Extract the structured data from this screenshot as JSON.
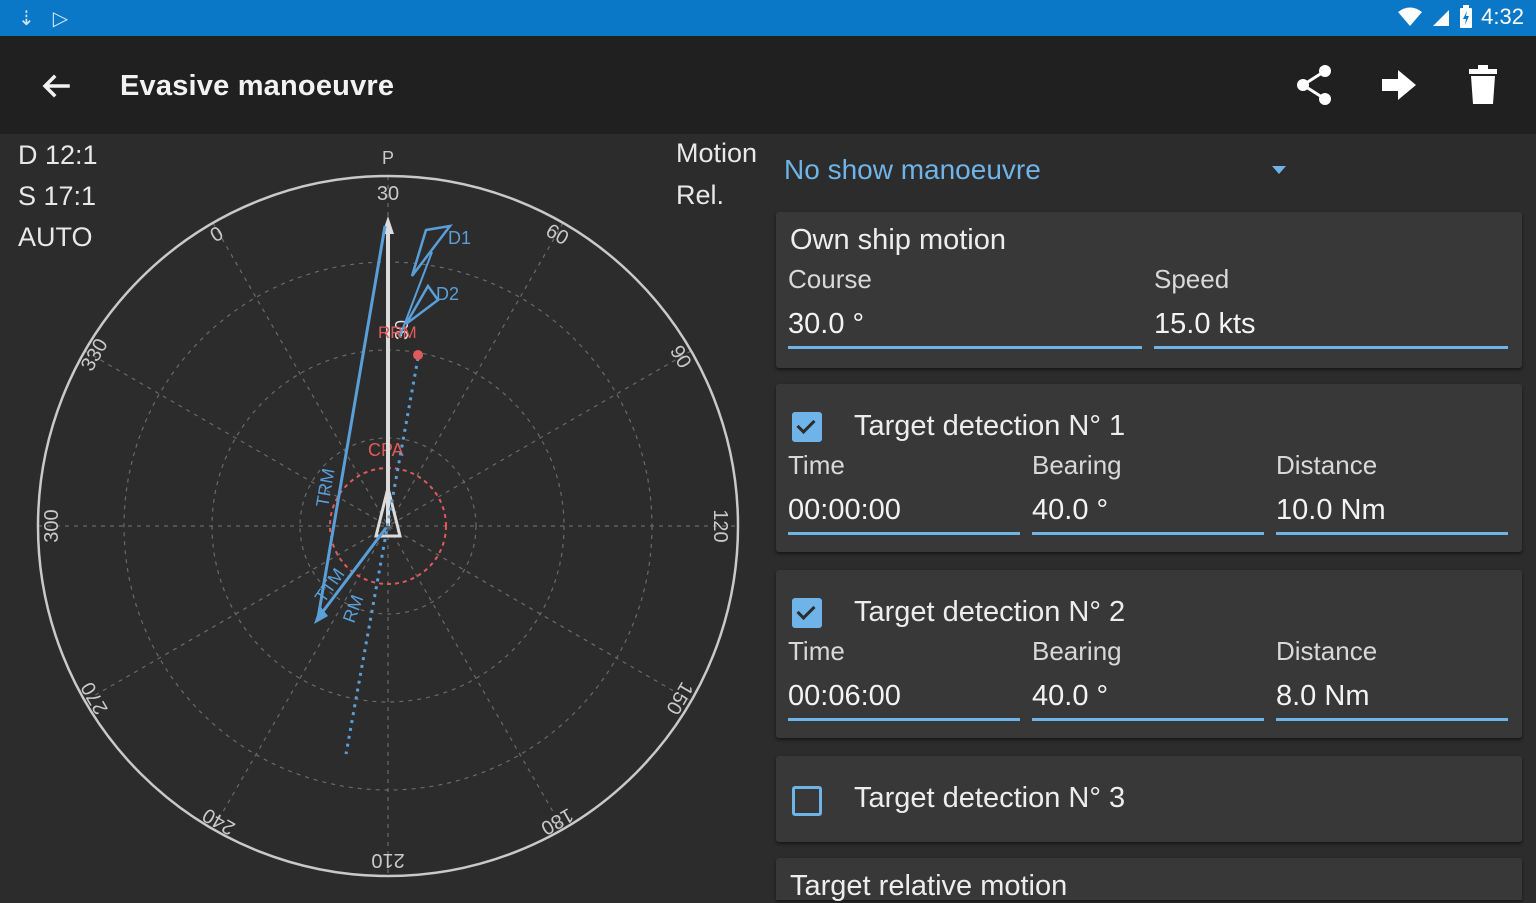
{
  "status": {
    "time": "4:32"
  },
  "appbar": {
    "title": "Evasive manoeuvre"
  },
  "plot_info": {
    "line1": "D 12:1",
    "line2": "S 17:1",
    "line3": "AUTO"
  },
  "motion": {
    "label": "Motion",
    "mode": "Rel."
  },
  "dropdown": {
    "selected": "No show manoeuvre"
  },
  "own_ship": {
    "title": "Own ship motion",
    "course_label": "Course",
    "course_value": "30.0 °",
    "speed_label": "Speed",
    "speed_value": "15.0 kts"
  },
  "detections": [
    {
      "title": "Target detection N° 1",
      "checked": true,
      "time_label": "Time",
      "time_value": "00:00:00",
      "bearing_label": "Bearing",
      "bearing_value": "40.0 °",
      "distance_label": "Distance",
      "distance_value": "10.0 Nm"
    },
    {
      "title": "Target detection N° 2",
      "checked": true,
      "time_label": "Time",
      "time_value": "00:06:00",
      "bearing_label": "Bearing",
      "bearing_value": "40.0 °",
      "distance_label": "Distance",
      "distance_value": "8.0 Nm"
    },
    {
      "title": "Target detection N° 3",
      "checked": false
    }
  ],
  "relative_motion": {
    "title": "Target relative motion"
  },
  "radar": {
    "top_marker": "P",
    "bearings": [
      "30",
      "60",
      "90",
      "120",
      "150",
      "180",
      "210",
      "240",
      "270",
      "300",
      "330",
      "0"
    ],
    "labels": {
      "d1": "D1",
      "d2": "D2",
      "cpa": "CPA",
      "trm": "TRM",
      "ttm": "TTM",
      "rm": "RM",
      "rrm": "RRM"
    },
    "colors": {
      "blue": "#5a9fd8",
      "red": "#e05a5a",
      "ring": "#c9c9c9",
      "grid": "#6a6a6a"
    }
  }
}
